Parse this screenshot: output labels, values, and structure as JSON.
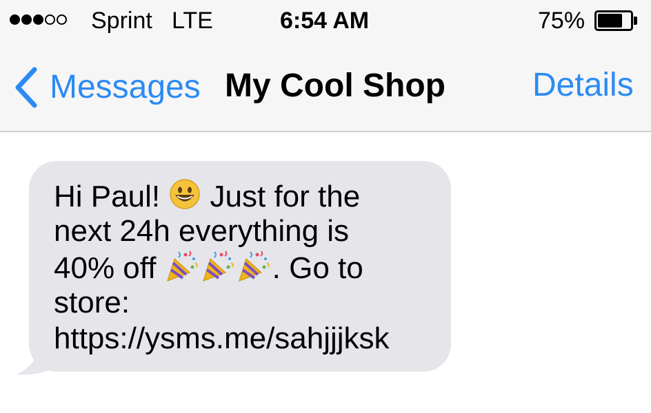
{
  "status_bar": {
    "carrier": "Sprint",
    "network": "LTE",
    "time": "6:54 AM",
    "battery_percent_label": "75%",
    "battery_level": 0.75,
    "signal_strength_dots": 3,
    "signal_total_dots": 5
  },
  "nav": {
    "back_label": "Messages",
    "title": "My Cool Shop",
    "details_label": "Details",
    "accent_color": "#2b8bf2"
  },
  "message": {
    "line1_pre": "Hi Paul! ",
    "line1_emoji": "grinning-face-emoji",
    "line1_post": " Just for the",
    "line2": "next 24h everything is",
    "line3_pre": "40% off ",
    "line3_emoji": "party-popper-emoji x3",
    "line3_post": ". Go to",
    "line4": "store:",
    "line5": "https://ysms.me/sahjjjksk",
    "bubble_color": "#e5e5ea"
  }
}
